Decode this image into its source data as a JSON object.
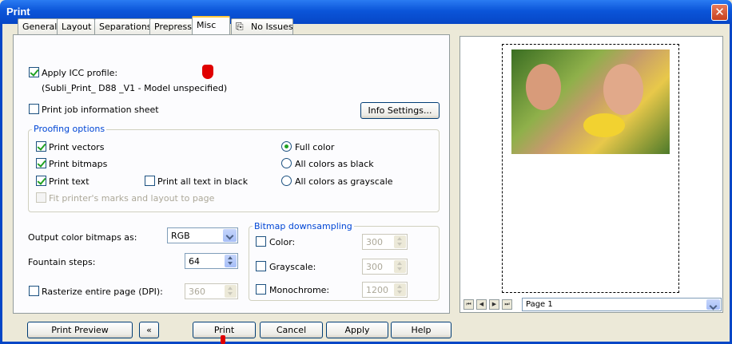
{
  "window": {
    "title": "Print"
  },
  "tabs": [
    "General",
    "Layout",
    "Separations",
    "Prepress",
    "Misc",
    "No Issues"
  ],
  "icc": {
    "apply_label": "Apply ICC profile:",
    "profile": "(Subli_Print_ D88 _V1 - Model unspecified)"
  },
  "job_info": {
    "label": "Print job information sheet",
    "button": "Info Settings..."
  },
  "proofing": {
    "title": "Proofing options",
    "print_vectors": "Print vectors",
    "print_bitmaps": "Print bitmaps",
    "print_text": "Print text",
    "print_all_text_black": "Print all text in black",
    "fit_marks": "Fit printer's marks and layout to page",
    "full_color": "Full color",
    "all_black": "All colors as black",
    "all_gray": "All colors as grayscale"
  },
  "output": {
    "color_label": "Output color bitmaps as:",
    "color_value": "RGB",
    "fountain_label": "Fountain steps:",
    "fountain_value": "64",
    "rasterize_label": "Rasterize entire page (DPI):",
    "rasterize_value": "360"
  },
  "downsampling": {
    "title": "Bitmap downsampling",
    "color_label": "Color:",
    "color_value": "300",
    "gray_label": "Grayscale:",
    "gray_value": "300",
    "mono_label": "Monochrome:",
    "mono_value": "1200"
  },
  "buttons": {
    "preview": "Print Preview",
    "collapse": "«",
    "print": "Print",
    "cancel": "Cancel",
    "apply": "Apply",
    "help": "Help"
  },
  "pager": {
    "page": "Page 1"
  },
  "colors": {
    "title_bar": "#0b55d9",
    "check": "#21a121",
    "cursor": "#e00000"
  }
}
